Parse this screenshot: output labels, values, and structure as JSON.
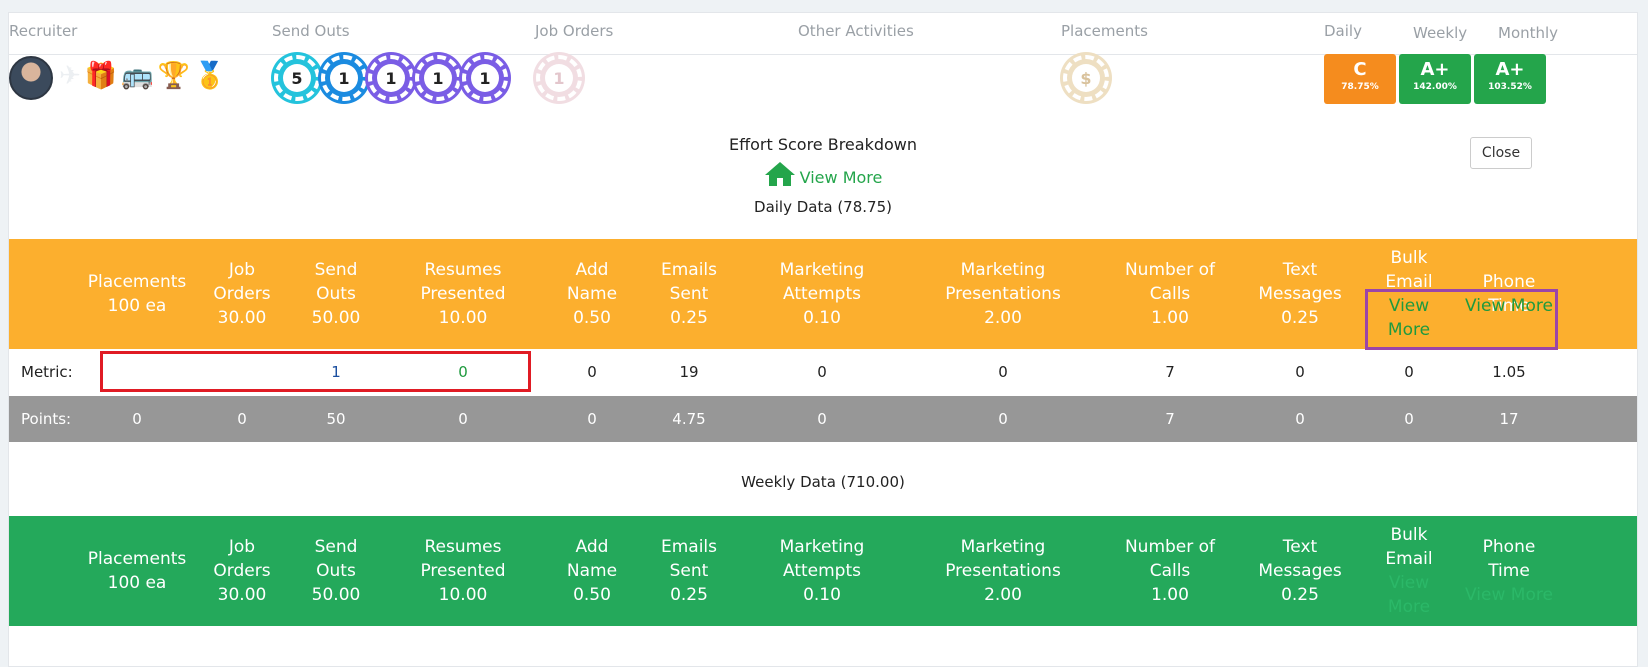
{
  "header": {
    "columns": [
      "Recruiter",
      "Send Outs",
      "Job Orders",
      "Other Activities",
      "Placements",
      "Daily",
      "Weekly",
      "Monthly"
    ],
    "badge_icons": "✈🎁🚌🏆🥇",
    "send_out_chips": [
      {
        "value": "5",
        "color": "cyan"
      },
      {
        "value": "1",
        "color": "blue"
      },
      {
        "value": "1",
        "color": "purple"
      },
      {
        "value": "1",
        "color": "purple"
      },
      {
        "value": "1",
        "color": "purple"
      }
    ],
    "job_order_chip": "1",
    "placement_chip": "$",
    "grades": {
      "daily": {
        "grade": "C",
        "pct": "78.75%",
        "color": "#f58c1e"
      },
      "weekly": {
        "grade": "A+",
        "pct": "142.00%",
        "color": "#24a54b"
      },
      "monthly": {
        "grade": "A+",
        "pct": "103.52%",
        "color": "#24a54b"
      }
    }
  },
  "breakdown": {
    "title": "Effort Score Breakdown",
    "view_more": "View More",
    "close": "Close",
    "daily_label": "Daily Data (78.75)",
    "weekly_label": "Weekly Data (710.00)"
  },
  "columns": [
    {
      "name": "Placements",
      "rate": "100 ea"
    },
    {
      "name": "Job Orders",
      "rate": "30.00"
    },
    {
      "name": "Send Outs",
      "rate": "50.00"
    },
    {
      "name": "Resumes Presented",
      "rate": "10.00"
    },
    {
      "name": "Add Name",
      "rate": "0.50"
    },
    {
      "name": "Emails Sent",
      "rate": "0.25"
    },
    {
      "name": "Marketing Attempts",
      "rate": "0.10"
    },
    {
      "name": "Marketing Presentations",
      "rate": "2.00"
    },
    {
      "name": "Number of Calls",
      "rate": "1.00"
    },
    {
      "name": "Text Messages",
      "rate": "0.25"
    },
    {
      "name": "Bulk Email",
      "rate": "View More"
    },
    {
      "name": "Phone Time",
      "rate": "View More"
    }
  ],
  "metric_row": {
    "label": "Metric:",
    "values": [
      "",
      "",
      "1",
      "0",
      "0",
      "19",
      "0",
      "0",
      "7",
      "0",
      "0",
      "1.05"
    ]
  },
  "points_row": {
    "label": "Points:",
    "values": [
      "0",
      "0",
      "50",
      "0",
      "0",
      "4.75",
      "0",
      "0",
      "7",
      "0",
      "0",
      "17"
    ]
  }
}
